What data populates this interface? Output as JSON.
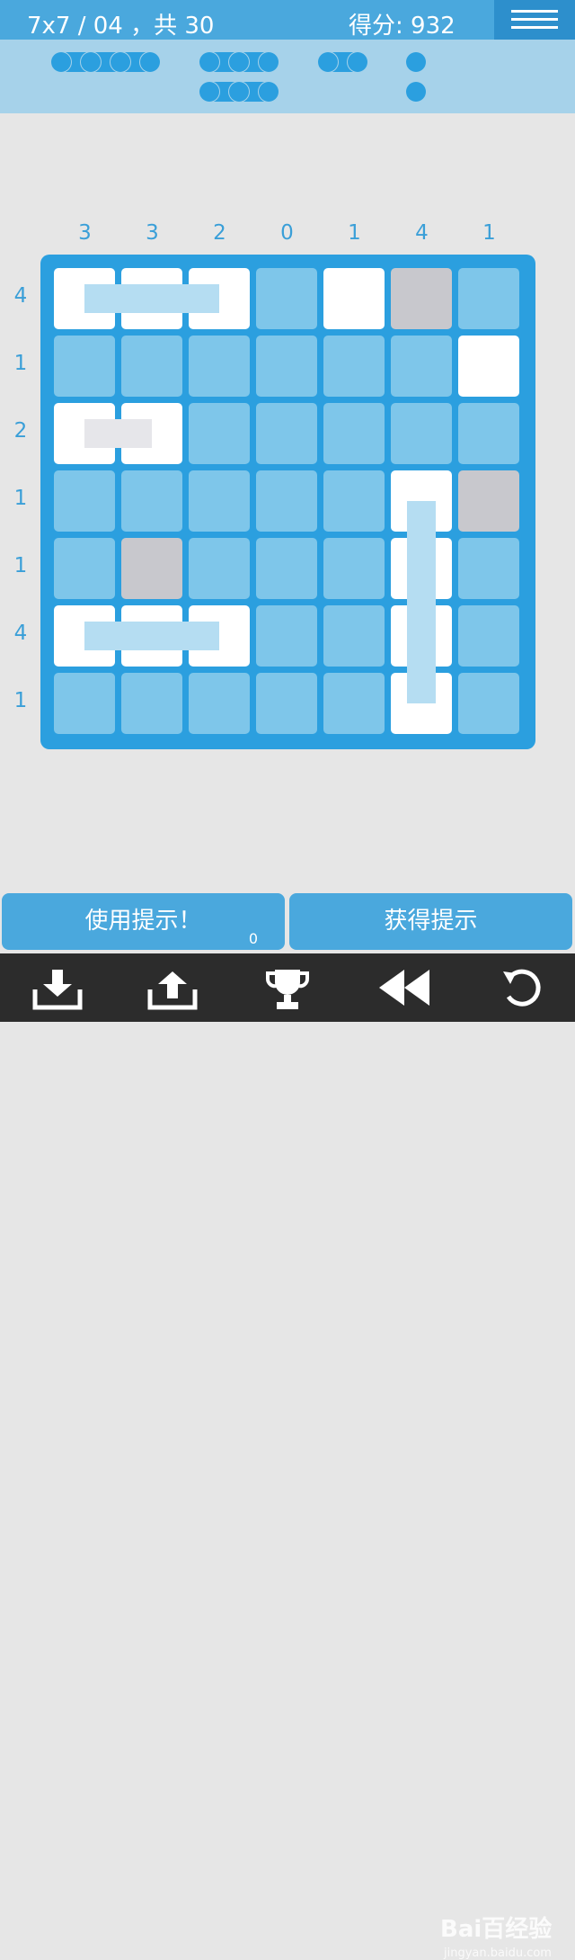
{
  "header": {
    "level": "7x7 / 04",
    "total": "，共 30",
    "score_label": "得分:",
    "score_value": "932"
  },
  "clues": {
    "columns": [
      "3",
      "3",
      "2",
      "0",
      "1",
      "4",
      "1"
    ],
    "rows": [
      "4",
      "1",
      "2",
      "1",
      "1",
      "4",
      "1"
    ]
  },
  "board": {
    "size": 7,
    "cells_note": "S=ship segment, W=water (grey), empty=unknown",
    "grid": [
      [
        "S",
        "S",
        "S",
        "",
        "S",
        "W",
        ""
      ],
      [
        "",
        "",
        "",
        "",
        "",
        "",
        "S"
      ],
      [
        "Sg",
        "S",
        "",
        "",
        "",
        "",
        ""
      ],
      [
        "",
        "",
        "",
        "",
        "",
        "S",
        "W"
      ],
      [
        "",
        "W",
        "",
        "",
        "",
        "S",
        ""
      ],
      [
        "S",
        "S",
        "S",
        "",
        "",
        "Sg",
        ""
      ],
      [
        "",
        "",
        "",
        "",
        "",
        "S",
        ""
      ]
    ]
  },
  "fleet": [
    {
      "length": 4
    },
    {
      "length": 3
    },
    {
      "length": 3
    },
    {
      "length": 2
    },
    {
      "length": 1
    },
    {
      "length": 1
    }
  ],
  "buttons": {
    "use_hint": "使用提示！",
    "hint_count": "0",
    "get_hint": "获得提示"
  },
  "toolbar": {
    "icons": [
      "download-icon",
      "upload-icon",
      "trophy-icon",
      "rewind-icon",
      "undo-icon"
    ]
  },
  "watermark": {
    "text": "Bai百经验",
    "sub": "jingyan.baidu.com"
  },
  "colors": {
    "accent": "#2b9fdf",
    "header": "#4aa8dd",
    "unknown_cell": "#7ec6ea",
    "water_cell": "#c8c8cd"
  }
}
